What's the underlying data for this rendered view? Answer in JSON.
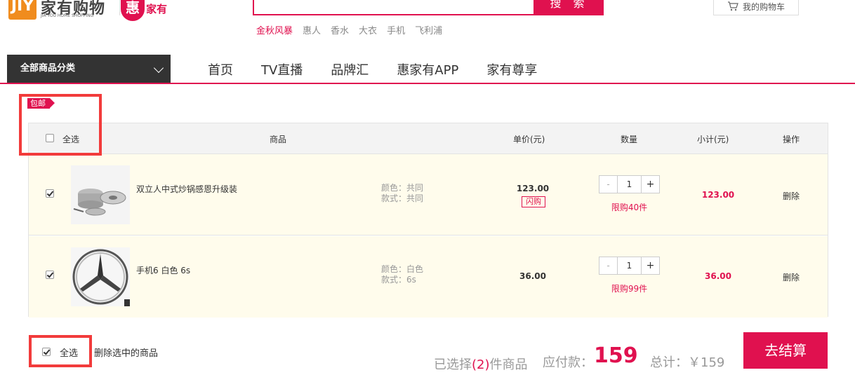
{
  "header": {
    "logo_mark": "JIY",
    "logo_text": "家有购物",
    "logo_sub": "JIA YOU HOME SHOPPING",
    "hui_char": "惠",
    "hui_text": "家有",
    "search_button": "搜 索",
    "hot_words": [
      "金秋风暴",
      "惠人",
      "香水",
      "大衣",
      "手机",
      "飞利浦"
    ],
    "cart_label": "我的购物车"
  },
  "nav": {
    "category_label": "全部商品分类",
    "links": [
      "首页",
      "TV直播",
      "品牌汇",
      "惠家有APP",
      "家有尊享"
    ]
  },
  "cart": {
    "free_shipping_tag": "包邮",
    "headers": {
      "select_all": "全选",
      "product": "商品",
      "unit_price": "单价(元)",
      "quantity": "数量",
      "subtotal": "小计(元)",
      "action": "操作"
    },
    "items": [
      {
        "checked": true,
        "name": "双立人中式炒锅感恩升级装",
        "color": "颜色：共同",
        "style": "款式：共同",
        "price": "123.00",
        "flash_tag": "闪购",
        "quantity": "1",
        "limit": "限购40件",
        "subtotal": "123.00",
        "delete": "删除"
      },
      {
        "checked": true,
        "name": "手机6 白色 6s",
        "color": "颜色：白色",
        "style": "款式：6s",
        "price": "36.00",
        "flash_tag": "",
        "quantity": "1",
        "limit": "限购99件",
        "subtotal": "36.00",
        "delete": "删除"
      }
    ]
  },
  "footer": {
    "select_all": "全选",
    "delete_selected": "删除选中的商品",
    "selected_prefix": "已选择",
    "selected_count": "(2)",
    "selected_suffix": "件商品",
    "payable_label": "应付款：",
    "payable_amount": "159",
    "total_label": "总计：￥159",
    "checkout_button": "去结算"
  },
  "colors": {
    "accent": "#e0114f",
    "highlight_box": "#f23b3b",
    "row_bg": "#fffcec"
  }
}
